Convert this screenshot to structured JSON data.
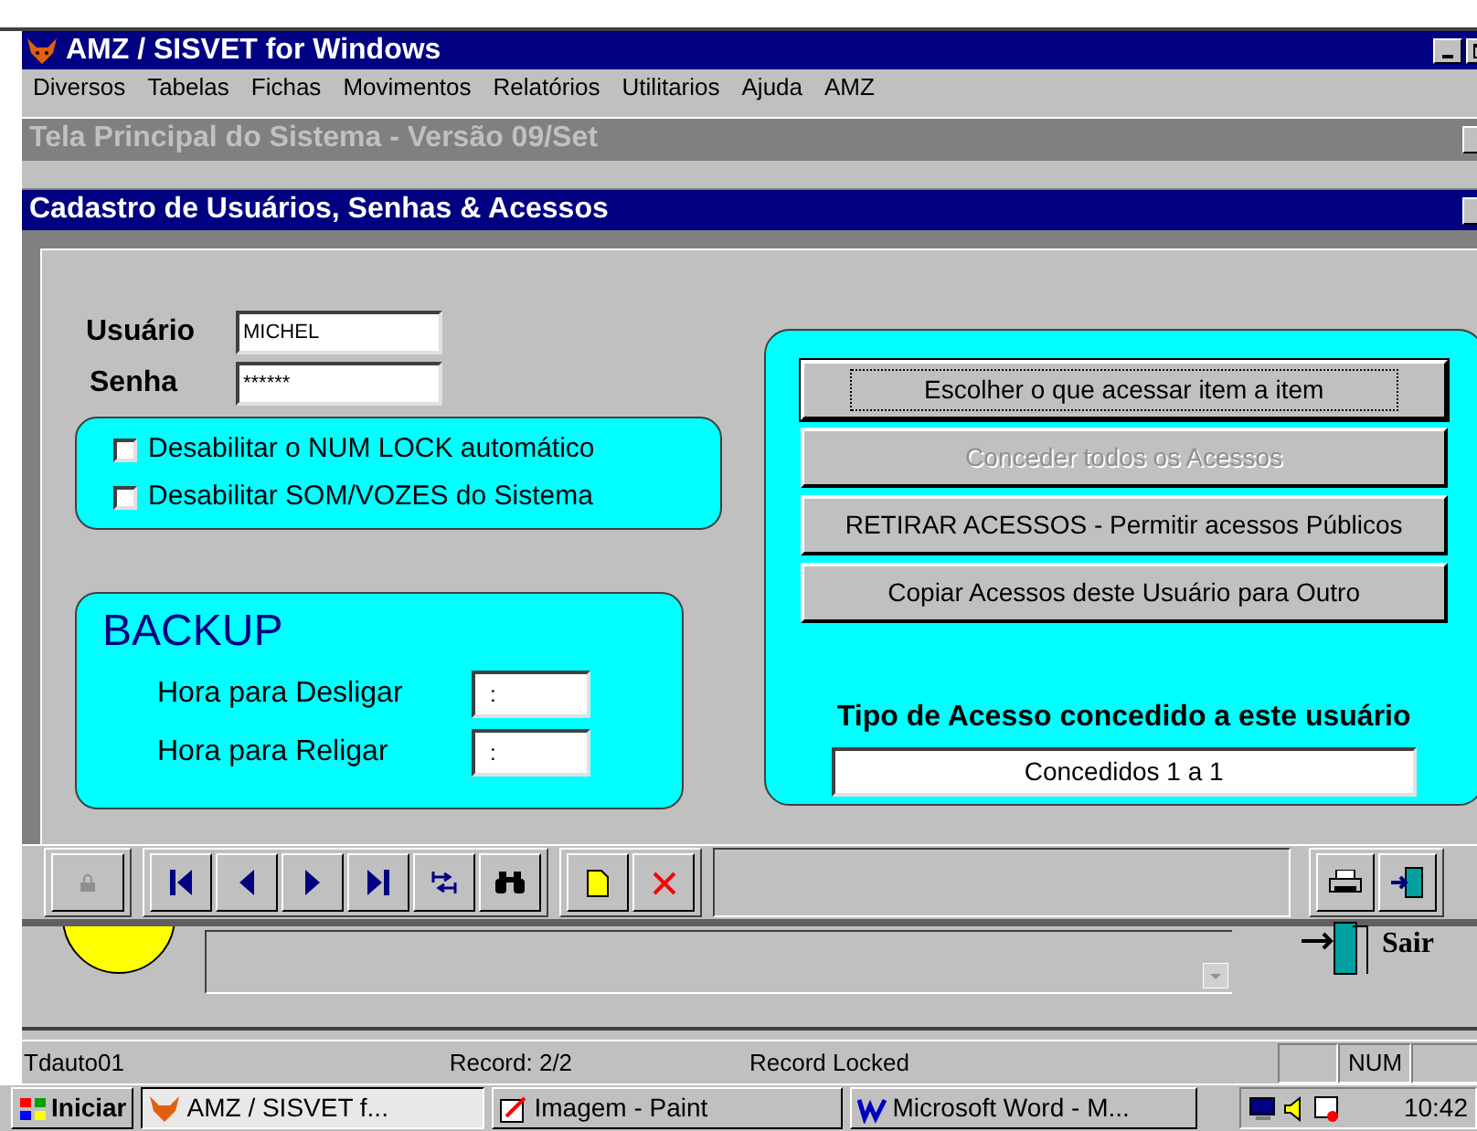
{
  "app": {
    "title": "AMZ / SISVET for Windows"
  },
  "menu": [
    {
      "label": "Diversos"
    },
    {
      "label": "Tabelas"
    },
    {
      "label": "Fichas"
    },
    {
      "label": "Movimentos"
    },
    {
      "label": "Relatórios"
    },
    {
      "label": "Utilitarios"
    },
    {
      "label": "Ajuda"
    },
    {
      "label": "AMZ"
    }
  ],
  "back_window": {
    "title": "Tela Principal do Sistema - Versão 09/Set"
  },
  "dialog": {
    "title": "Cadastro de Usuários, Senhas & Acessos",
    "user": {
      "label": "Usuário",
      "value": "MICHEL"
    },
    "password": {
      "label": "Senha",
      "value": "******"
    },
    "options": [
      {
        "label": "Desabilitar o NUM LOCK automático",
        "checked": false
      },
      {
        "label": "Desabilitar SOM/VOZES do Sistema",
        "checked": false
      }
    ],
    "backup": {
      "title": "BACKUP",
      "fields": [
        {
          "label": "Hora para Desligar",
          "value": ":"
        },
        {
          "label": "Hora para Religar",
          "value": ":"
        }
      ]
    },
    "access_buttons": [
      {
        "label": "Escolher o que acessar item a item",
        "disabled": false,
        "focused": true
      },
      {
        "label": "Conceder todos os Acessos",
        "disabled": true,
        "focused": false
      },
      {
        "label": "RETIRAR ACESSOS - Permitir acessos Públicos",
        "disabled": false,
        "focused": false
      },
      {
        "label": "Copiar Acessos deste Usuário para Outro",
        "disabled": false,
        "focused": false
      }
    ],
    "access_type": {
      "label": "Tipo de Acesso concedido a este usuário",
      "value": "Concedidos 1 a 1"
    }
  },
  "exit_label": "Sair",
  "status_bar": {
    "texts": [
      "Tdauto01",
      "Record: 2/2",
      "Record Locked"
    ],
    "indicator": "NUM"
  },
  "taskbar": {
    "start": "Iniciar",
    "tasks": [
      {
        "label": "AMZ / SISVET f...",
        "selected": true
      },
      {
        "label": "Imagem - Paint",
        "selected": false
      },
      {
        "label": "Microsoft Word - M...",
        "selected": false
      }
    ],
    "clock": "10:42"
  }
}
